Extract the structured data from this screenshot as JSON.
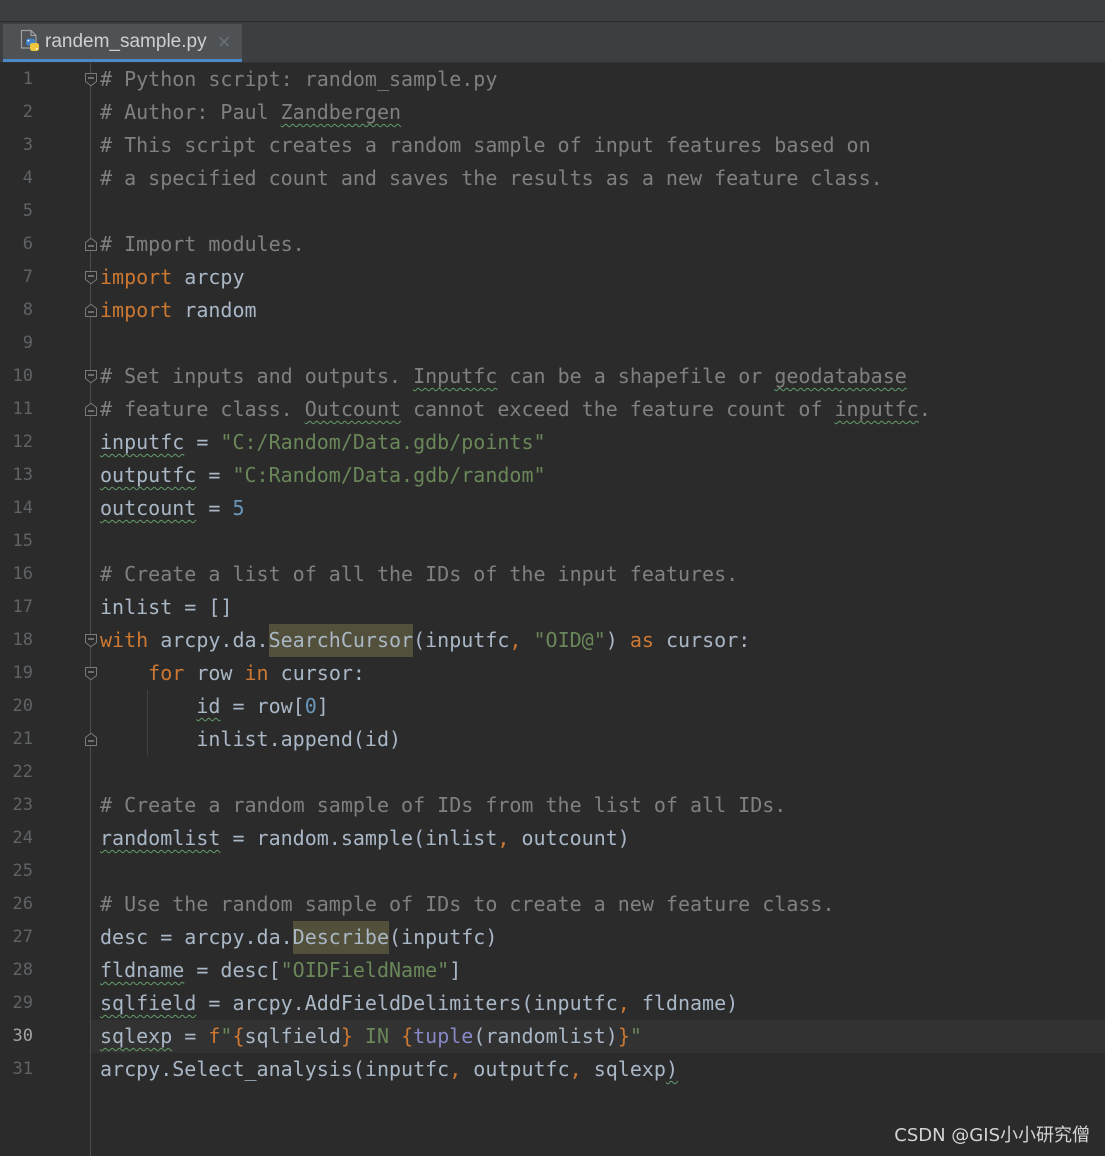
{
  "tab": {
    "label": "randem_sample.py",
    "icon": "python-file-icon",
    "close_icon": "close-icon",
    "close_glyph": "×"
  },
  "editor": {
    "current_line": 30,
    "lines": [
      {
        "number": "1",
        "fold": "start",
        "tokens": [
          {
            "t": "# Python script: random_sample.py",
            "k": "comment"
          }
        ]
      },
      {
        "number": "2",
        "tokens": [
          {
            "t": "# Author: Paul ",
            "k": "comment"
          },
          {
            "t": "Zandbergen",
            "k": "comment",
            "typo": true
          }
        ]
      },
      {
        "number": "3",
        "tokens": [
          {
            "t": "# This script creates a random sample of input features based on",
            "k": "comment"
          }
        ]
      },
      {
        "number": "4",
        "tokens": [
          {
            "t": "# a specified count and saves the results as a new feature class.",
            "k": "comment"
          }
        ]
      },
      {
        "number": "5",
        "tokens": []
      },
      {
        "number": "6",
        "fold": "end",
        "tokens": [
          {
            "t": "# Import modules.",
            "k": "comment"
          }
        ]
      },
      {
        "number": "7",
        "fold": "start",
        "tokens": [
          {
            "t": "import",
            "k": "keyword"
          },
          {
            "t": " arcpy",
            "k": "text"
          }
        ]
      },
      {
        "number": "8",
        "fold": "end",
        "tokens": [
          {
            "t": "import",
            "k": "keyword"
          },
          {
            "t": " random",
            "k": "text"
          }
        ]
      },
      {
        "number": "9",
        "tokens": []
      },
      {
        "number": "10",
        "fold": "start",
        "tokens": [
          {
            "t": "# Set inputs and outputs. ",
            "k": "comment"
          },
          {
            "t": "Inputfc",
            "k": "comment",
            "typo": true
          },
          {
            "t": " can be a shapefile or ",
            "k": "comment"
          },
          {
            "t": "geodatabase",
            "k": "comment",
            "typo": true
          }
        ]
      },
      {
        "number": "11",
        "fold": "end",
        "tokens": [
          {
            "t": "# feature class. ",
            "k": "comment"
          },
          {
            "t": "Outcount",
            "k": "comment",
            "typo": true
          },
          {
            "t": " cannot exceed the feature count of ",
            "k": "comment"
          },
          {
            "t": "inputfc",
            "k": "comment",
            "typo": true
          },
          {
            "t": ".",
            "k": "comment"
          }
        ]
      },
      {
        "number": "12",
        "tokens": [
          {
            "t": "inputfc",
            "k": "text",
            "typo": true
          },
          {
            "t": " = ",
            "k": "text"
          },
          {
            "t": "\"C:/Random/Data.gdb/points\"",
            "k": "string"
          }
        ]
      },
      {
        "number": "13",
        "tokens": [
          {
            "t": "outputfc",
            "k": "text",
            "typo": true
          },
          {
            "t": " = ",
            "k": "text"
          },
          {
            "t": "\"C:Random/Data.gdb/random\"",
            "k": "string"
          }
        ]
      },
      {
        "number": "14",
        "tokens": [
          {
            "t": "outcount",
            "k": "text",
            "typo": true
          },
          {
            "t": " = ",
            "k": "text"
          },
          {
            "t": "5",
            "k": "number"
          }
        ]
      },
      {
        "number": "15",
        "tokens": []
      },
      {
        "number": "16",
        "tokens": [
          {
            "t": "# Create a list of all the IDs of the input features.",
            "k": "comment"
          }
        ]
      },
      {
        "number": "17",
        "tokens": [
          {
            "t": "inlist = []",
            "k": "text"
          }
        ]
      },
      {
        "number": "18",
        "fold": "start",
        "tokens": [
          {
            "t": "with",
            "k": "keyword"
          },
          {
            "t": " arcpy.da.",
            "k": "text"
          },
          {
            "t": "SearchCursor",
            "k": "text",
            "hl": true
          },
          {
            "t": "(inputfc",
            "k": "text"
          },
          {
            "t": ",",
            "k": "punct"
          },
          {
            "t": " ",
            "k": "text"
          },
          {
            "t": "\"OID@\"",
            "k": "string"
          },
          {
            "t": ") ",
            "k": "text"
          },
          {
            "t": "as",
            "k": "keyword"
          },
          {
            "t": " cursor:",
            "k": "text"
          }
        ]
      },
      {
        "number": "19",
        "fold": "start",
        "tokens": [
          {
            "t": "    ",
            "k": "text"
          },
          {
            "t": "for",
            "k": "keyword"
          },
          {
            "t": " row ",
            "k": "text"
          },
          {
            "t": "in",
            "k": "keyword"
          },
          {
            "t": " cursor:",
            "k": "text"
          }
        ]
      },
      {
        "number": "20",
        "tokens": [
          {
            "t": "        ",
            "k": "text"
          },
          {
            "t": "id",
            "k": "text",
            "typo": true
          },
          {
            "t": " = row[",
            "k": "text"
          },
          {
            "t": "0",
            "k": "number"
          },
          {
            "t": "]",
            "k": "text"
          }
        ]
      },
      {
        "number": "21",
        "fold": "end",
        "tokens": [
          {
            "t": "        inlist.append(id)",
            "k": "text"
          }
        ]
      },
      {
        "number": "22",
        "tokens": []
      },
      {
        "number": "23",
        "tokens": [
          {
            "t": "# Create a random sample of IDs from the list of all IDs.",
            "k": "comment"
          }
        ]
      },
      {
        "number": "24",
        "tokens": [
          {
            "t": "randomlist",
            "k": "text",
            "typo": true
          },
          {
            "t": " = random.sample(inlist",
            "k": "text"
          },
          {
            "t": ",",
            "k": "punct"
          },
          {
            "t": " outcount)",
            "k": "text"
          }
        ]
      },
      {
        "number": "25",
        "tokens": []
      },
      {
        "number": "26",
        "tokens": [
          {
            "t": "# Use the random sample of IDs to create a new feature class.",
            "k": "comment"
          }
        ]
      },
      {
        "number": "27",
        "tokens": [
          {
            "t": "desc = arcpy.da.",
            "k": "text"
          },
          {
            "t": "Describe",
            "k": "text",
            "hl": true
          },
          {
            "t": "(inputfc)",
            "k": "text"
          }
        ]
      },
      {
        "number": "28",
        "tokens": [
          {
            "t": "fldname",
            "k": "text",
            "typo": true
          },
          {
            "t": " = desc[",
            "k": "text"
          },
          {
            "t": "\"OIDFieldName\"",
            "k": "string"
          },
          {
            "t": "]",
            "k": "text"
          }
        ]
      },
      {
        "number": "29",
        "tokens": [
          {
            "t": "sqlfield",
            "k": "text",
            "typo": true
          },
          {
            "t": " = arcpy.AddFieldDelimiters(inputfc",
            "k": "text"
          },
          {
            "t": ",",
            "k": "punct"
          },
          {
            "t": " fldname)",
            "k": "text"
          }
        ]
      },
      {
        "number": "30",
        "tokens": [
          {
            "t": "sqlexp",
            "k": "text",
            "typo": true
          },
          {
            "t": " = ",
            "k": "text"
          },
          {
            "t": "f",
            "k": "keyword"
          },
          {
            "t": "\"",
            "k": "string"
          },
          {
            "t": "{",
            "k": "fbrace"
          },
          {
            "t": "sqlfield",
            "k": "text"
          },
          {
            "t": "}",
            "k": "fbrace"
          },
          {
            "t": " IN ",
            "k": "string"
          },
          {
            "t": "{",
            "k": "fbrace"
          },
          {
            "t": "tuple",
            "k": "builtin"
          },
          {
            "t": "(randomlist)",
            "k": "text"
          },
          {
            "t": "}",
            "k": "fbrace"
          },
          {
            "t": "\"",
            "k": "string"
          }
        ]
      },
      {
        "number": "31",
        "tokens": [
          {
            "t": "arcpy.Select_analysis(inputfc",
            "k": "text"
          },
          {
            "t": ",",
            "k": "punct"
          },
          {
            "t": " outputfc",
            "k": "text"
          },
          {
            "t": ",",
            "k": "punct"
          },
          {
            "t": " sqlexp",
            "k": "text"
          },
          {
            "t": ")",
            "k": "text",
            "typo": true
          }
        ]
      }
    ]
  },
  "watermark": "CSDN @GIS小小研究僧",
  "theme": {
    "background": "#2b2b2b",
    "default_text": "#a9b7c6",
    "comment": "#808080",
    "keyword": "#cc7832",
    "string": "#6a8759",
    "number": "#6897bb",
    "builtin": "#8888c6",
    "fstring_brace": "#cc7832",
    "line_number": "#606366",
    "current_line_number": "#a4a3a3",
    "current_line_background": "#323232",
    "usage_highlight": "#52503a",
    "typo_underline": "#659c6b",
    "tab_underline": "#4a88c7"
  }
}
